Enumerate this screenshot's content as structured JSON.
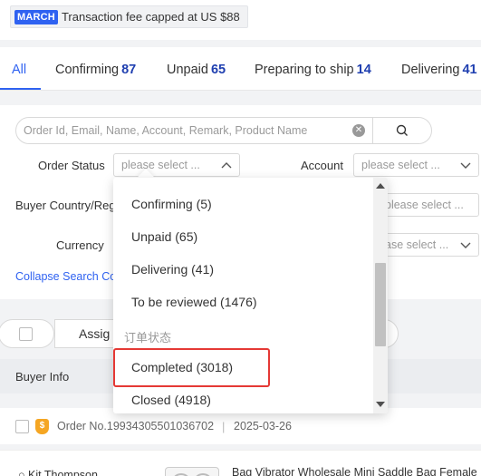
{
  "promo": {
    "badge": "MARCH",
    "text": "Transaction fee capped at US $88"
  },
  "tabs": [
    {
      "label": "All",
      "count": ""
    },
    {
      "label": "Confirming",
      "count": "87"
    },
    {
      "label": "Unpaid",
      "count": "65"
    },
    {
      "label": "Preparing to ship",
      "count": "14"
    },
    {
      "label": "Delivering",
      "count": "41"
    }
  ],
  "filters": {
    "search_placeholder": "Order Id, Email, Name, Account, Remark, Product Name",
    "order_status_label": "Order Status",
    "order_status_placeholder": "please select ...",
    "account_label": "Account",
    "account_placeholder": "please select ...",
    "buyer_country_label": "Buyer Country/Regi",
    "buyer_country_placeholder": "please select ...",
    "currency_label": "Currency",
    "currency_placeholder": "ase select ...",
    "collapse_label": "Collapse Search Co"
  },
  "actions": {
    "assign_label": "Assig"
  },
  "table": {
    "buyer_info_header": "Buyer Info"
  },
  "order": {
    "order_no": "Order No.19934305501036702",
    "separator": "|",
    "date": "2025-03-26",
    "buyer_name": "Kit Thompson",
    "product_title": "Bag Vibrator Wholesale Mini Saddle Bag Female"
  },
  "dropdown": {
    "options": [
      "Confirming  (5)",
      "Unpaid  (65)",
      "Delivering  (41)",
      "To be reviewed  (1476)"
    ],
    "group_label": "订单状态",
    "group_options": [
      "Completed  (3018)",
      "Closed  (4918)"
    ]
  },
  "colors": {
    "accent": "#2f62f1",
    "count": "#1f3fb0",
    "highlight": "#e53935"
  }
}
